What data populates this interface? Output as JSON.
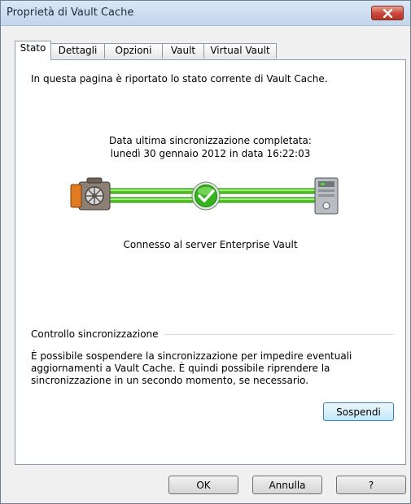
{
  "window": {
    "title": "Proprietà di Vault Cache"
  },
  "tabs": [
    {
      "label": "Stato",
      "active": true
    },
    {
      "label": "Dettagli",
      "active": false
    },
    {
      "label": "Opzioni",
      "active": false
    },
    {
      "label": "Vault",
      "active": false
    },
    {
      "label": "Virtual Vault",
      "active": false
    }
  ],
  "status_tab": {
    "intro": "In questa pagina è riportato lo stato corrente di Vault Cache.",
    "sync_line1": "Data ultima sincronizzazione completata:",
    "sync_line2": "lunedì 30 gennaio 2012 in data 16:22:03",
    "connection_status": "Connesso al server Enterprise Vault",
    "group_title": "Controllo sincronizzazione",
    "group_text": "È possibile sospendere la sincronizzazione per impedire eventuali aggiornamenti a Vault Cache. È quindi possibile riprendere la sincronizzazione in un secondo momento, se necessario.",
    "suspend_label": "Sospendi"
  },
  "footer": {
    "ok_label": "OK",
    "cancel_label": "Annulla",
    "help_label": "?"
  },
  "icons": {
    "vault": "vault-safe-icon",
    "check": "checkmark-icon",
    "server": "server-icon",
    "close": "close-icon"
  },
  "colors": {
    "link_green": "#4fc41f",
    "check_green": "#35b420",
    "close_red": "#c9453a"
  }
}
